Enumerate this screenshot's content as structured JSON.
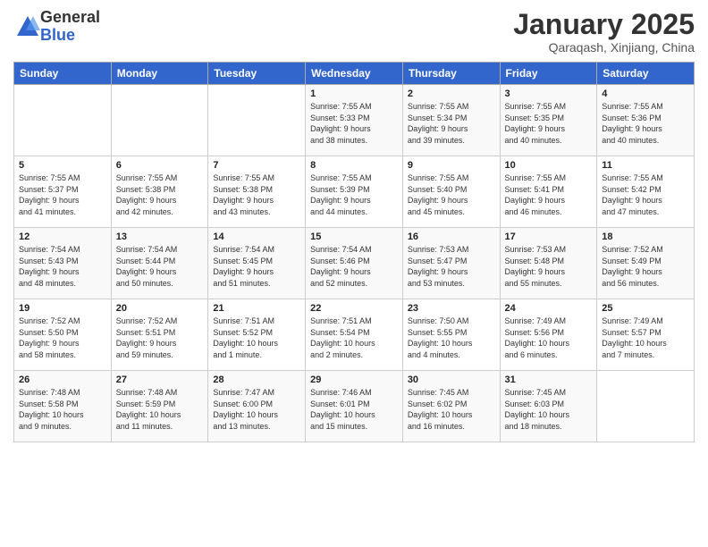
{
  "logo": {
    "general": "General",
    "blue": "Blue"
  },
  "header": {
    "month": "January 2025",
    "location": "Qaraqash, Xinjiang, China"
  },
  "weekdays": [
    "Sunday",
    "Monday",
    "Tuesday",
    "Wednesday",
    "Thursday",
    "Friday",
    "Saturday"
  ],
  "weeks": [
    [
      {
        "day": "",
        "text": ""
      },
      {
        "day": "",
        "text": ""
      },
      {
        "day": "",
        "text": ""
      },
      {
        "day": "1",
        "text": "Sunrise: 7:55 AM\nSunset: 5:33 PM\nDaylight: 9 hours\nand 38 minutes."
      },
      {
        "day": "2",
        "text": "Sunrise: 7:55 AM\nSunset: 5:34 PM\nDaylight: 9 hours\nand 39 minutes."
      },
      {
        "day": "3",
        "text": "Sunrise: 7:55 AM\nSunset: 5:35 PM\nDaylight: 9 hours\nand 40 minutes."
      },
      {
        "day": "4",
        "text": "Sunrise: 7:55 AM\nSunset: 5:36 PM\nDaylight: 9 hours\nand 40 minutes."
      }
    ],
    [
      {
        "day": "5",
        "text": "Sunrise: 7:55 AM\nSunset: 5:37 PM\nDaylight: 9 hours\nand 41 minutes."
      },
      {
        "day": "6",
        "text": "Sunrise: 7:55 AM\nSunset: 5:38 PM\nDaylight: 9 hours\nand 42 minutes."
      },
      {
        "day": "7",
        "text": "Sunrise: 7:55 AM\nSunset: 5:38 PM\nDaylight: 9 hours\nand 43 minutes."
      },
      {
        "day": "8",
        "text": "Sunrise: 7:55 AM\nSunset: 5:39 PM\nDaylight: 9 hours\nand 44 minutes."
      },
      {
        "day": "9",
        "text": "Sunrise: 7:55 AM\nSunset: 5:40 PM\nDaylight: 9 hours\nand 45 minutes."
      },
      {
        "day": "10",
        "text": "Sunrise: 7:55 AM\nSunset: 5:41 PM\nDaylight: 9 hours\nand 46 minutes."
      },
      {
        "day": "11",
        "text": "Sunrise: 7:55 AM\nSunset: 5:42 PM\nDaylight: 9 hours\nand 47 minutes."
      }
    ],
    [
      {
        "day": "12",
        "text": "Sunrise: 7:54 AM\nSunset: 5:43 PM\nDaylight: 9 hours\nand 48 minutes."
      },
      {
        "day": "13",
        "text": "Sunrise: 7:54 AM\nSunset: 5:44 PM\nDaylight: 9 hours\nand 50 minutes."
      },
      {
        "day": "14",
        "text": "Sunrise: 7:54 AM\nSunset: 5:45 PM\nDaylight: 9 hours\nand 51 minutes."
      },
      {
        "day": "15",
        "text": "Sunrise: 7:54 AM\nSunset: 5:46 PM\nDaylight: 9 hours\nand 52 minutes."
      },
      {
        "day": "16",
        "text": "Sunrise: 7:53 AM\nSunset: 5:47 PM\nDaylight: 9 hours\nand 53 minutes."
      },
      {
        "day": "17",
        "text": "Sunrise: 7:53 AM\nSunset: 5:48 PM\nDaylight: 9 hours\nand 55 minutes."
      },
      {
        "day": "18",
        "text": "Sunrise: 7:52 AM\nSunset: 5:49 PM\nDaylight: 9 hours\nand 56 minutes."
      }
    ],
    [
      {
        "day": "19",
        "text": "Sunrise: 7:52 AM\nSunset: 5:50 PM\nDaylight: 9 hours\nand 58 minutes."
      },
      {
        "day": "20",
        "text": "Sunrise: 7:52 AM\nSunset: 5:51 PM\nDaylight: 9 hours\nand 59 minutes."
      },
      {
        "day": "21",
        "text": "Sunrise: 7:51 AM\nSunset: 5:52 PM\nDaylight: 10 hours\nand 1 minute."
      },
      {
        "day": "22",
        "text": "Sunrise: 7:51 AM\nSunset: 5:54 PM\nDaylight: 10 hours\nand 2 minutes."
      },
      {
        "day": "23",
        "text": "Sunrise: 7:50 AM\nSunset: 5:55 PM\nDaylight: 10 hours\nand 4 minutes."
      },
      {
        "day": "24",
        "text": "Sunrise: 7:49 AM\nSunset: 5:56 PM\nDaylight: 10 hours\nand 6 minutes."
      },
      {
        "day": "25",
        "text": "Sunrise: 7:49 AM\nSunset: 5:57 PM\nDaylight: 10 hours\nand 7 minutes."
      }
    ],
    [
      {
        "day": "26",
        "text": "Sunrise: 7:48 AM\nSunset: 5:58 PM\nDaylight: 10 hours\nand 9 minutes."
      },
      {
        "day": "27",
        "text": "Sunrise: 7:48 AM\nSunset: 5:59 PM\nDaylight: 10 hours\nand 11 minutes."
      },
      {
        "day": "28",
        "text": "Sunrise: 7:47 AM\nSunset: 6:00 PM\nDaylight: 10 hours\nand 13 minutes."
      },
      {
        "day": "29",
        "text": "Sunrise: 7:46 AM\nSunset: 6:01 PM\nDaylight: 10 hours\nand 15 minutes."
      },
      {
        "day": "30",
        "text": "Sunrise: 7:45 AM\nSunset: 6:02 PM\nDaylight: 10 hours\nand 16 minutes."
      },
      {
        "day": "31",
        "text": "Sunrise: 7:45 AM\nSunset: 6:03 PM\nDaylight: 10 hours\nand 18 minutes."
      },
      {
        "day": "",
        "text": ""
      }
    ]
  ]
}
